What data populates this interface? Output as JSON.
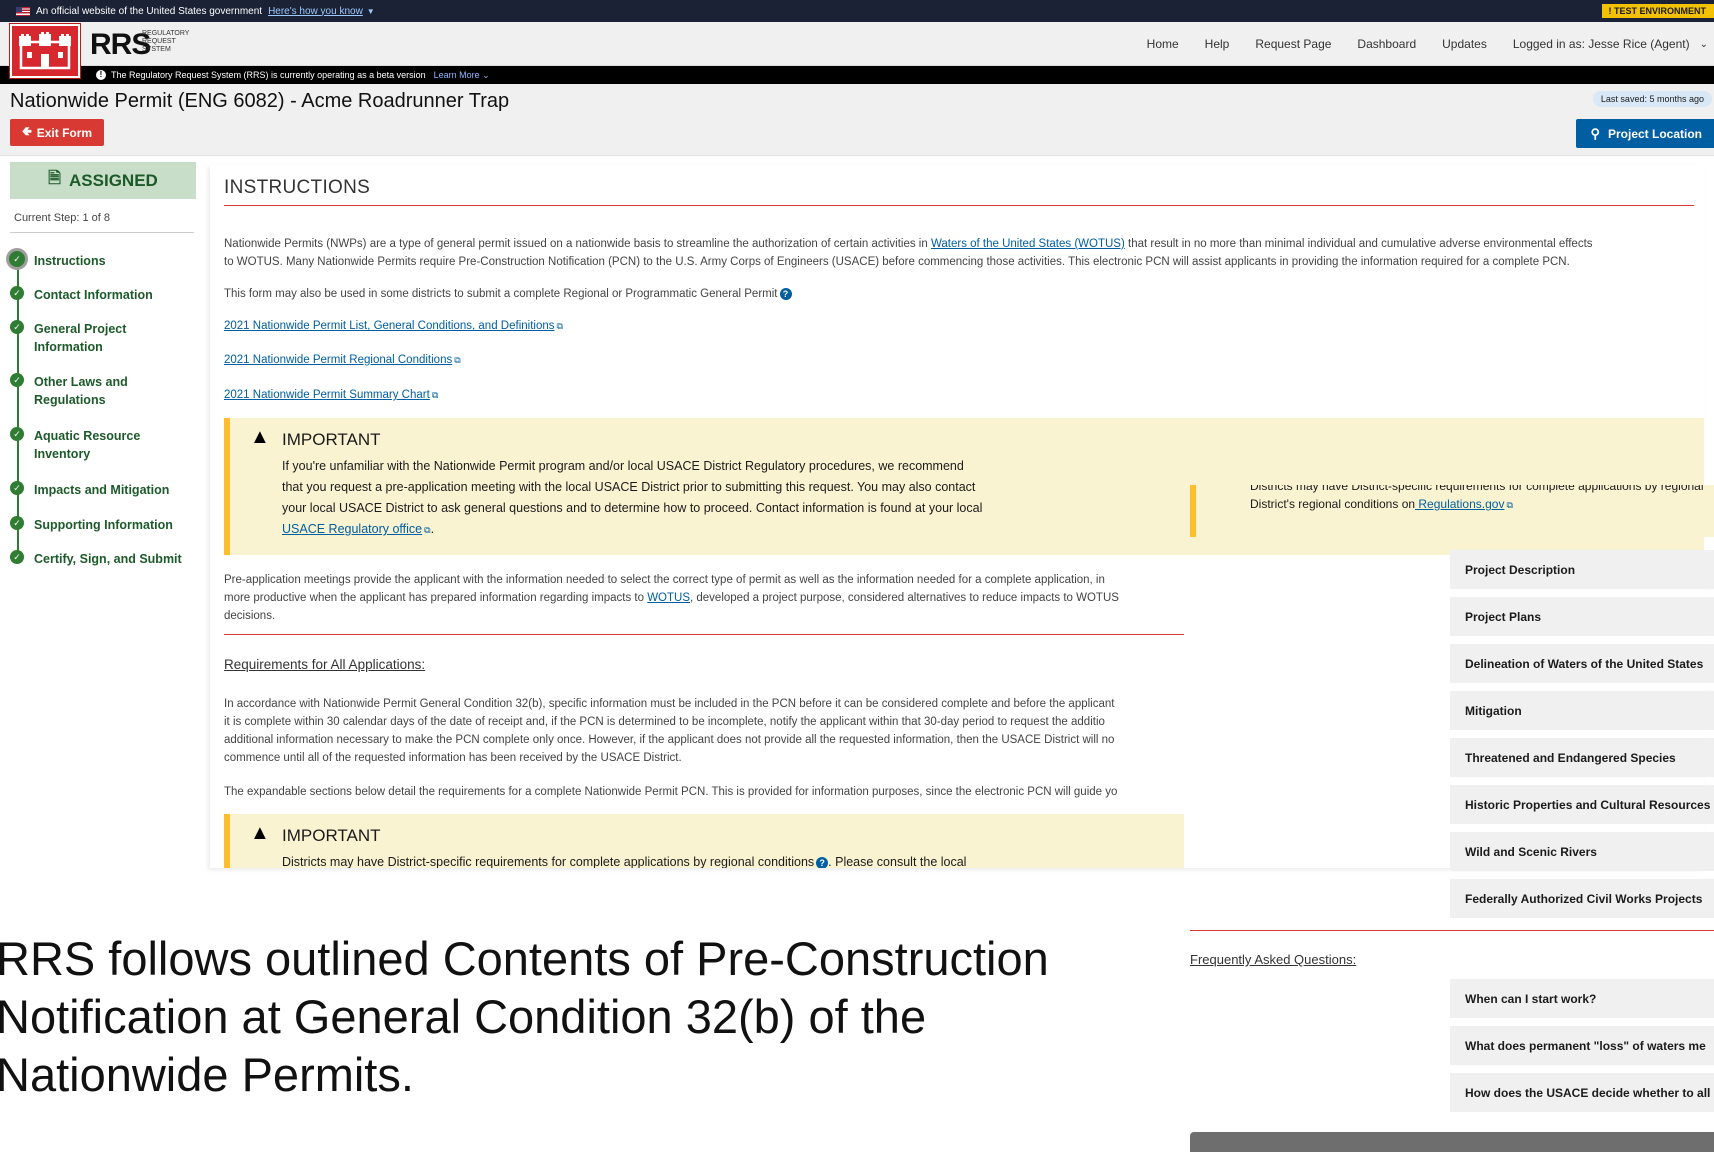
{
  "gov_banner": {
    "text": "An official website of the United States government",
    "link": "Here's how you know",
    "test_env": "! TEST ENVIRONMENT"
  },
  "header": {
    "logo_text": "RRS",
    "logo_sub_1": "REGULATORY",
    "logo_sub_2": "REQUEST",
    "logo_sub_3": "SYSTEM",
    "nav": [
      "Home",
      "Help",
      "Request Page",
      "Dashboard",
      "Updates"
    ],
    "logged_in": "Logged in as: Jesse Rice (Agent)"
  },
  "beta_bar": {
    "text": "The Regulatory Request System (RRS) is currently operating as a beta version",
    "learn_more": "Learn More"
  },
  "title_row": {
    "form_name": "Nationwide Permit (ENG 6082)",
    "separator": "-",
    "project_name": "Acme Roadrunner Trap",
    "exit_label": "Exit Form",
    "last_saved": "Last saved: 5 months ago",
    "project_location": "Project Location"
  },
  "sidebar": {
    "status": "ASSIGNED",
    "current_step": "Current Step: 1 of 8",
    "steps": [
      "Instructions",
      "Contact Information",
      "General Project Information",
      "Other Laws and Regulations",
      "Aquatic Resource Inventory",
      "Impacts and Mitigation",
      "Supporting Information",
      "Certify, Sign, and Submit"
    ]
  },
  "main": {
    "title": "INSTRUCTIONS",
    "intro_1a": "Nationwide Permits (NWPs) are a type of general permit issued on a nationwide basis to streamline the authorization of certain activities in ",
    "intro_1_link": "Waters of the United States (WOTUS)",
    "intro_1b": " that result in no more than minimal individual and cumulative adverse environmental effects",
    "intro_2": "to WOTUS. Many Nationwide Permits require Pre-Construction Notification (PCN) to the U.S. Army Corps of Engineers (USACE) before commencing those activities. This electronic PCN will assist applicants in providing the information required for a complete PCN.",
    "district_note": "This form may also be used in some districts to submit a complete Regional or Programmatic General Permit",
    "links": [
      "2021 Nationwide Permit List, General Conditions, and Definitions",
      "2021 Nationwide Permit Regional Conditions",
      "2021 Nationwide Permit Summary Chart"
    ],
    "important_1": {
      "title": "IMPORTANT",
      "line_1": "If you're unfamiliar with the Nationwide Permit program and/or local USACE District Regulatory procedures, we recommend",
      "line_2": "that you request a pre-application meeting with the local USACE District prior to submitting this request. You may also contact",
      "line_3": "your local USACE District to ask general questions and to determine how to proceed. Contact information is found at your local",
      "link": "USACE Regulatory office"
    },
    "pre_app_1": "Pre-application meetings provide the applicant with the information needed to select the correct type of permit as well as the information needed for a complete application, in",
    "pre_app_2a": "more productive when the applicant has prepared information regarding impacts to ",
    "pre_app_2_link": "WOTUS",
    "pre_app_2b": ", developed a project purpose, considered alternatives to reduce impacts to WOTUS",
    "pre_app_3": "decisions.",
    "req_heading": "Requirements for All Applications:",
    "req_1": "In accordance with Nationwide Permit General Condition 32(b), specific information must be included in the PCN before it can be considered complete and before the applicant",
    "req_2": "it is complete within 30 calendar days of the date of receipt and, if the PCN is determined to be incomplete, notify the applicant within that 30-day period to request the additio",
    "req_3": "additional information necessary to make the PCN complete only once. However, if the applicant does not provide all the requested information, then the USACE District will no",
    "req_4": "commence until all of the requested information has been received by the USACE District.",
    "expand_note": "The expandable sections below detail the requirements for a complete Nationwide Permit PCN. This is provided for information purposes, since the electronic PCN will guide yo",
    "important_2": {
      "title": "IMPORTANT",
      "line_1": "Districts may have District-specific requirements for complete applications by regional conditions",
      "line_1b": ". Please consult the local"
    }
  },
  "right_panel": {
    "imp_line_1": "Districts may have District-specific requirements for complete applications by regional",
    "imp_line_2": "District's regional conditions on",
    "imp_link": " Regulations.gov",
    "sections": [
      "Project Description",
      "Project Plans",
      "Delineation of Waters of the United States",
      "Mitigation",
      "Threatened and Endangered Species",
      "Historic Properties and Cultural Resources",
      "Wild and Scenic Rivers",
      "Federally Authorized Civil Works Projects"
    ],
    "faq_heading": "Frequently Asked Questions:",
    "faqs": [
      "When can I start work?",
      "What does permanent \"loss\" of waters me",
      "How does the USACE decide whether to all"
    ]
  },
  "caption": {
    "line_1": "RRS follows outlined Contents of Pre-Construction",
    "line_2": "Notification at General Condition 32(b) of the",
    "line_3": "Nationwide Permits."
  }
}
